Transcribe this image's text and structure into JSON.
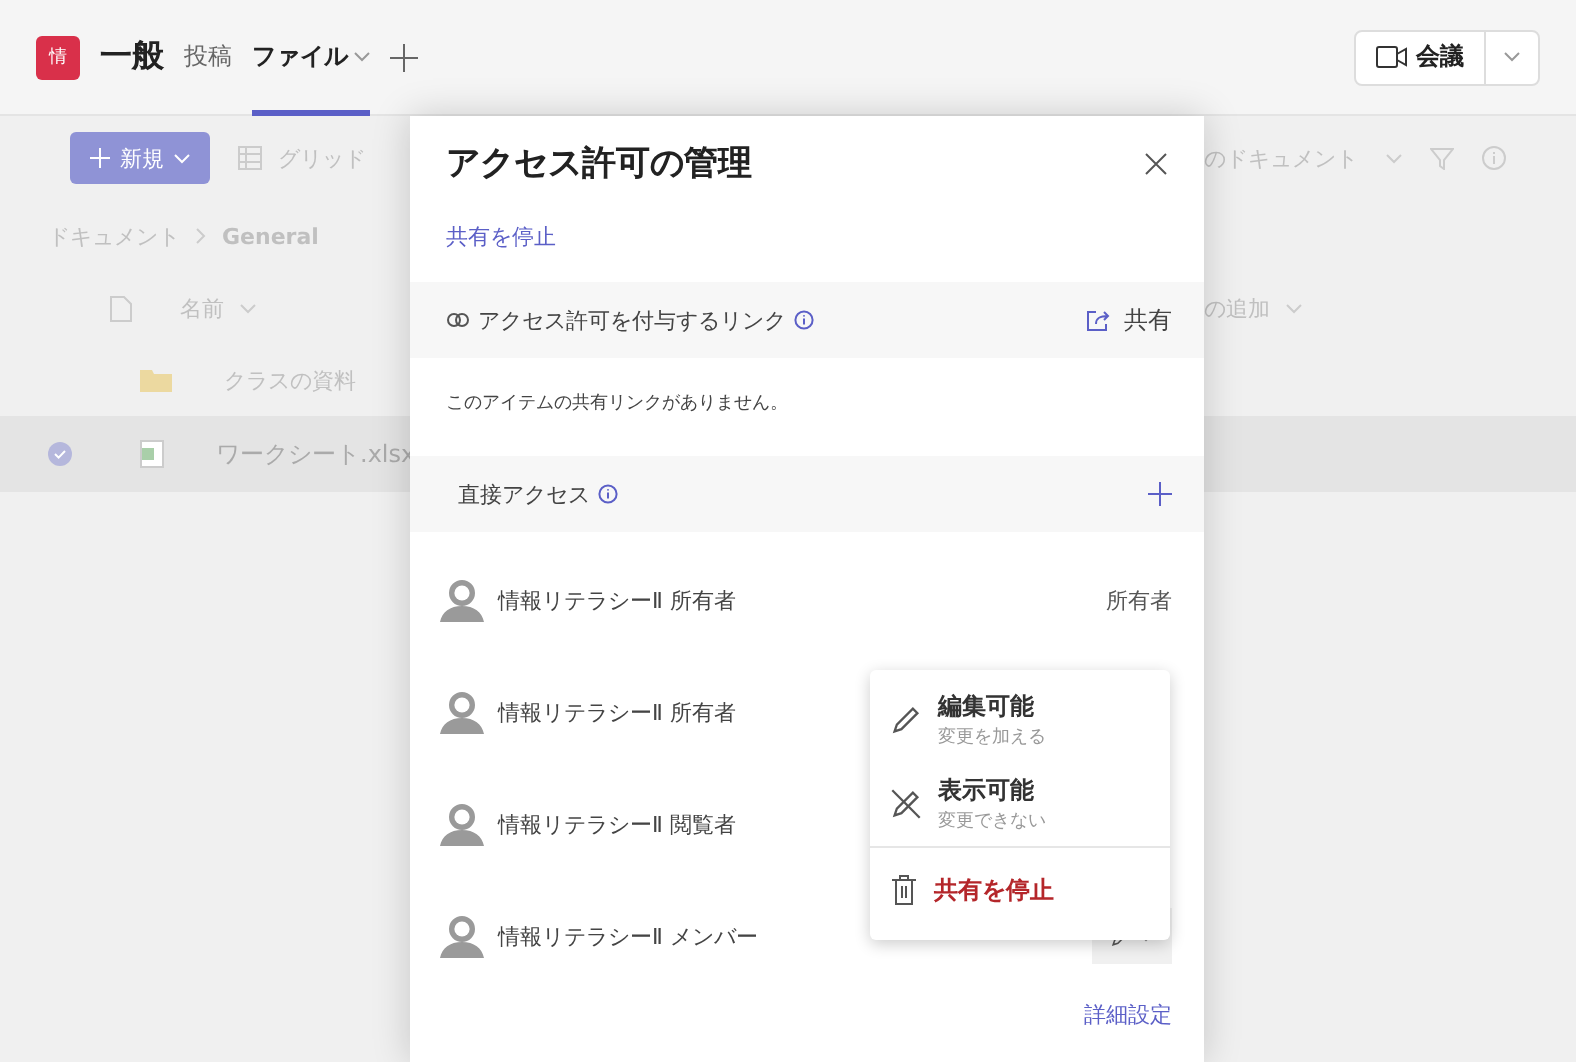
{
  "header": {
    "team_avatar": "情",
    "channel": "一般",
    "tabs": [
      {
        "label": "投稿",
        "selected": false,
        "has_menu": false
      },
      {
        "label": "ファイル",
        "selected": true,
        "has_menu": true
      }
    ],
    "meet_button": "会議"
  },
  "toolbar": {
    "new_button": "新規",
    "view": "グリッド",
    "library": "のドキュメント"
  },
  "breadcrumb": [
    "ドキュメント",
    "General"
  ],
  "list": {
    "columns": [
      "名前",
      "の追加"
    ],
    "rows": [
      {
        "name": "クラスの資料",
        "kind": "folder",
        "selected": false
      },
      {
        "name": "ワークシート.xlsx",
        "kind": "excel",
        "selected": true
      }
    ]
  },
  "panel": {
    "title": "アクセス許可の管理",
    "stop_link": "共有を停止",
    "links_section": {
      "title": "アクセス許可を付与するリンク",
      "share": "共有",
      "empty": "このアイテムの共有リンクがありません。"
    },
    "direct_section": {
      "title": "直接アクセス"
    },
    "people": [
      {
        "name": "情報リテラシーⅡ 所有者",
        "kind": "label",
        "role": "所有者"
      },
      {
        "name": "情報リテラシーⅡ 所有者",
        "kind": "none"
      },
      {
        "name": "情報リテラシーⅡ 閲覧者",
        "kind": "none"
      },
      {
        "name": "情報リテラシーⅡ メンバー",
        "kind": "editor"
      }
    ],
    "advanced": "詳細設定",
    "menu": {
      "items": [
        {
          "kind": "edit",
          "title": "編集可能",
          "subtitle": "変更を加える"
        },
        {
          "kind": "view",
          "title": "表示可能",
          "subtitle": "変更できない"
        },
        {
          "kind": "remove",
          "title": "共有を停止"
        }
      ]
    }
  }
}
